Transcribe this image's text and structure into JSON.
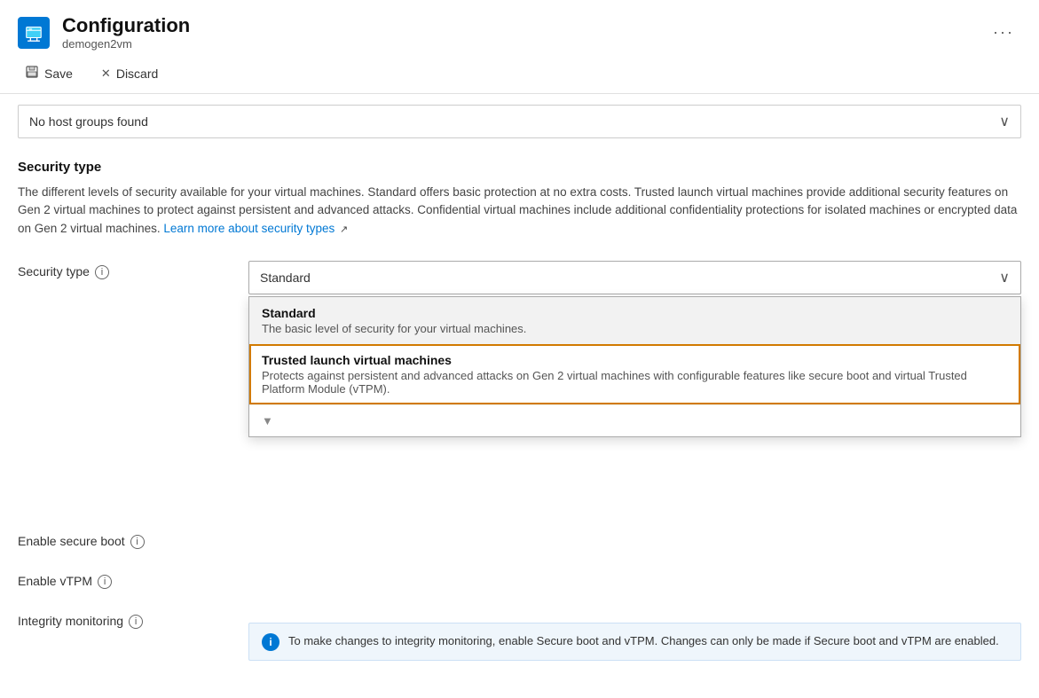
{
  "header": {
    "title": "Configuration",
    "subtitle": "demogen2vm",
    "more_label": "···"
  },
  "toolbar": {
    "save_label": "Save",
    "discard_label": "Discard"
  },
  "host_group_dropdown": {
    "value": "No host groups found"
  },
  "security_section": {
    "title": "Security type",
    "description": "The different levels of security available for your virtual machines. Standard offers basic protection at no extra costs. Trusted launch virtual machines provide additional security features on Gen 2 virtual machines to protect against persistent and advanced attacks. Confidential virtual machines include additional confidentiality protections for isolated machines or encrypted data on Gen 2 virtual machines.",
    "learn_more_link": "Learn more about security types"
  },
  "form": {
    "security_type_label": "Security type",
    "enable_secure_boot_label": "Enable secure boot",
    "enable_vtpm_label": "Enable vTPM",
    "integrity_monitoring_label": "Integrity monitoring",
    "security_type_value": "Standard"
  },
  "dropdown_options": [
    {
      "id": "standard",
      "title": "Standard",
      "description": "The basic level of security for your virtual machines.",
      "selected": true,
      "highlighted": false
    },
    {
      "id": "trusted",
      "title": "Trusted launch virtual machines",
      "description": "Protects against persistent and advanced attacks on Gen 2 virtual machines with configurable features like secure boot and virtual Trusted Platform Module (vTPM).",
      "selected": false,
      "highlighted": true
    }
  ],
  "info_banner": {
    "text": "To make changes to integrity monitoring, enable Secure boot and vTPM. Changes can only be made if Secure boot and vTPM are enabled."
  },
  "icons": {
    "info": "i",
    "chevron_down": "∨",
    "save": "💾",
    "discard": "✕"
  }
}
